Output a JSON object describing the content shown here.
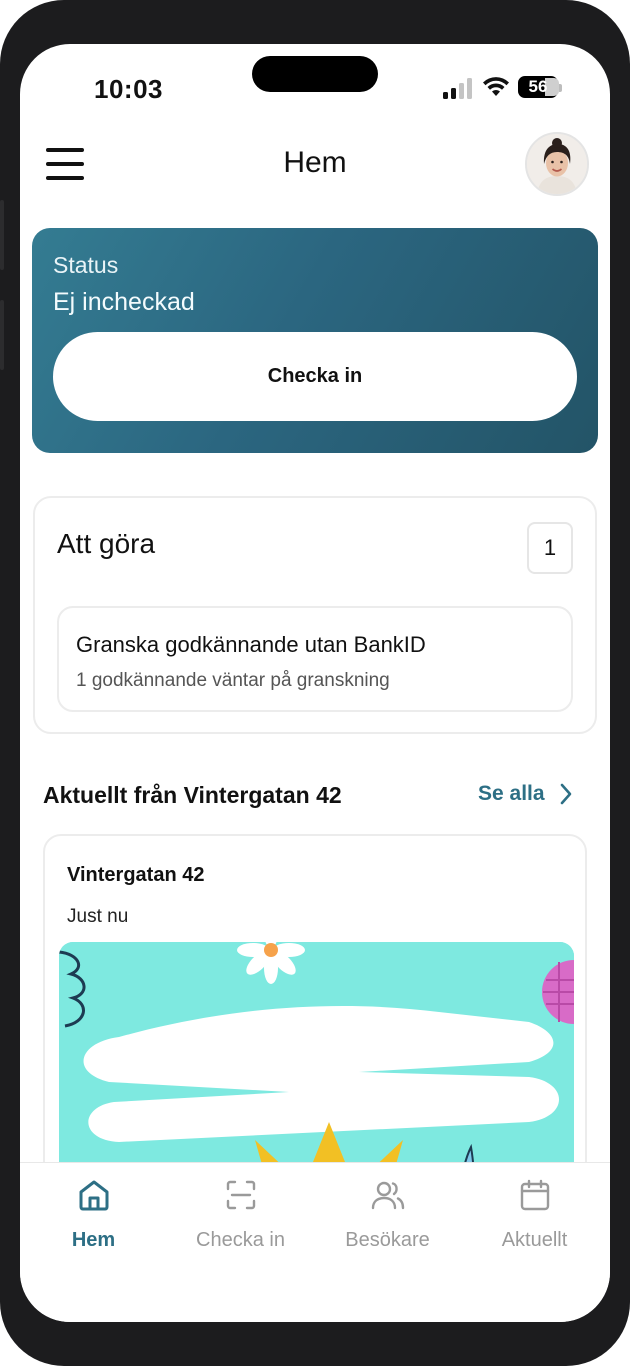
{
  "status_bar": {
    "time": "10:03",
    "battery_level": "56"
  },
  "header": {
    "title": "Hem"
  },
  "status_card": {
    "label": "Status",
    "value": "Ej incheckad",
    "button_label": "Checka in"
  },
  "todo": {
    "title": "Att göra",
    "count": "1",
    "items": [
      {
        "title": "Granska godkännande utan BankID",
        "subtitle": "1 godkännande väntar på granskning"
      }
    ]
  },
  "news": {
    "heading": "Aktuellt från Vintergatan 42",
    "see_all_label": "Se alla",
    "posts": [
      {
        "author": "Vintergatan 42",
        "time": "Just nu"
      }
    ]
  },
  "tabs": [
    {
      "label": "Hem",
      "icon": "home-icon",
      "active": true
    },
    {
      "label": "Checka in",
      "icon": "scan-icon",
      "active": false
    },
    {
      "label": "Besökare",
      "icon": "users-icon",
      "active": false
    },
    {
      "label": "Aktuellt",
      "icon": "calendar-icon",
      "active": false
    }
  ],
  "colors": {
    "accent": "#2d6f85",
    "status_card_start": "#347c92",
    "status_card_end": "#235467",
    "inactive_tab": "#9a9a9a"
  }
}
